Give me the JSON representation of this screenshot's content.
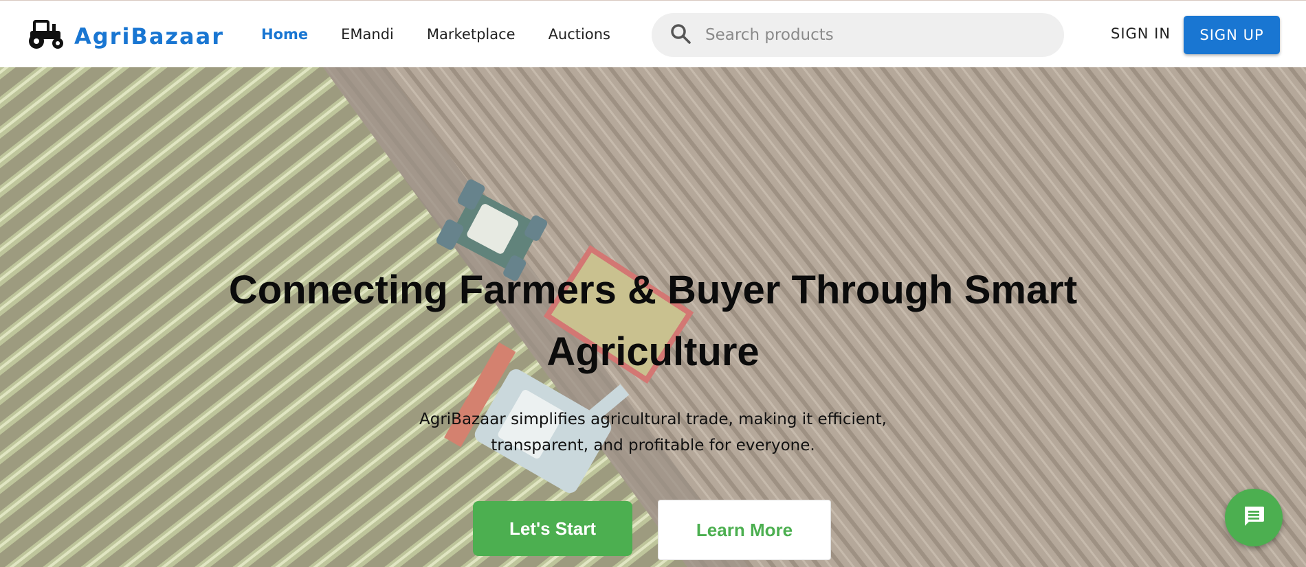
{
  "brand": {
    "name": "AgriBazaar",
    "color": "#1976d2",
    "logo_icon": "tractor-icon"
  },
  "nav": {
    "items": [
      {
        "label": "Home",
        "active": true
      },
      {
        "label": "EMandi",
        "active": false
      },
      {
        "label": "Marketplace",
        "active": false
      },
      {
        "label": "Auctions",
        "active": false
      }
    ]
  },
  "search": {
    "placeholder": "Search products",
    "value": "",
    "icon": "search-icon"
  },
  "auth": {
    "signin_label": "SIGN IN",
    "signup_label": "SIGN UP"
  },
  "hero": {
    "title": "Connecting Farmers & Buyer Through Smart Agriculture",
    "subtitle": "AgriBazaar simplifies agricultural trade, making it efficient, transparent, and profitable for everyone.",
    "primary_button": "Let's Start",
    "secondary_button": "Learn More",
    "background": "aerial-farm-field-harvest-image"
  },
  "chat": {
    "icon": "chat-icon"
  },
  "colors": {
    "primary": "#1976d2",
    "accent": "#4caf50"
  }
}
